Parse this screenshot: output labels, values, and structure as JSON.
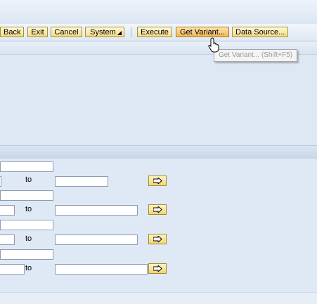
{
  "toolbar": {
    "back": "Back",
    "exit": "Exit",
    "cancel": "Cancel",
    "system": "System",
    "execute": "Execute",
    "get_variant": "Get Variant...",
    "data_source": "Data Source..."
  },
  "tooltip": "Get Variant... (Shift+F5)",
  "selection_rows": [
    {
      "to_label": "to"
    },
    {
      "to_label": "to"
    },
    {
      "to_label": "to"
    },
    {
      "to_label": "to"
    }
  ],
  "icons": {
    "system_menu": "triangle-icon",
    "multiple_selection": "arrow-right-icon",
    "cursor": "hand-pointer-icon"
  }
}
